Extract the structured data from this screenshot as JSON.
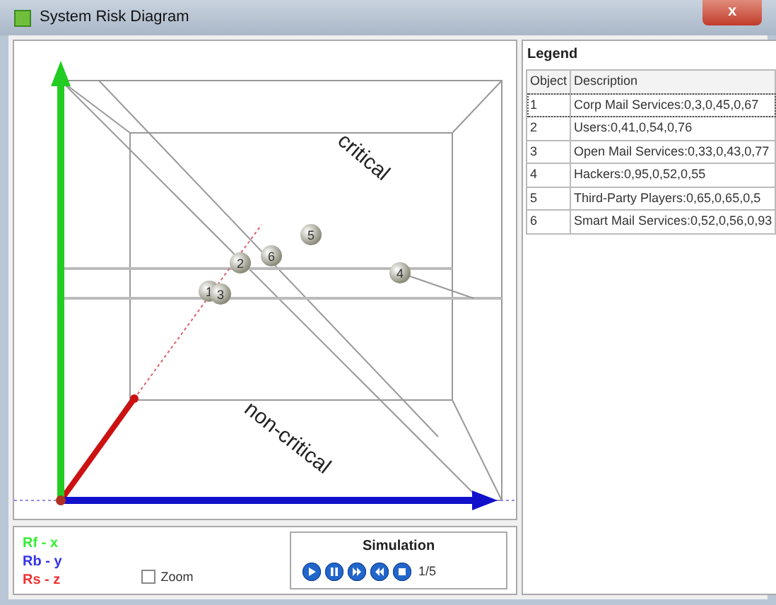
{
  "window": {
    "title": "System Risk Diagram",
    "close_label": "x"
  },
  "diagram": {
    "upper_label": "critical",
    "lower_label": "non-critical",
    "markers": [
      {
        "label": "1"
      },
      {
        "label": "3"
      },
      {
        "label": "2"
      },
      {
        "label": "6"
      },
      {
        "label": "5"
      },
      {
        "label": "4"
      }
    ]
  },
  "axis_key": [
    {
      "text": "Rf - x",
      "color": "#33ee33"
    },
    {
      "text": "Rb - y",
      "color": "#3333ee"
    },
    {
      "text": "Rs - z",
      "color": "#ee3333"
    }
  ],
  "zoom": {
    "label": "Zoom",
    "checked": false
  },
  "simulation": {
    "title": "Simulation",
    "controls": [
      {
        "kind": "play"
      },
      {
        "kind": "pause"
      },
      {
        "kind": "forward"
      },
      {
        "kind": "rewind"
      },
      {
        "kind": "stop"
      }
    ],
    "step": "1/5"
  },
  "legend": {
    "title": "Legend",
    "columns": [
      "Object",
      "Description"
    ],
    "rows": [
      {
        "object": "1",
        "description": "Corp Mail Services:0,3,0,45,0,67",
        "selected": true
      },
      {
        "object": "2",
        "description": "Users:0,41,0,54,0,76",
        "selected": false
      },
      {
        "object": "3",
        "description": "Open Mail Services:0,33,0,43,0,77",
        "selected": false
      },
      {
        "object": "4",
        "description": "Hackers:0,95,0,52,0,55",
        "selected": false
      },
      {
        "object": "5",
        "description": "Third-Party Players:0,65,0,65,0,5",
        "selected": false
      },
      {
        "object": "6",
        "description": "Smart Mail Services:0,52,0,56,0,93",
        "selected": false
      }
    ]
  }
}
